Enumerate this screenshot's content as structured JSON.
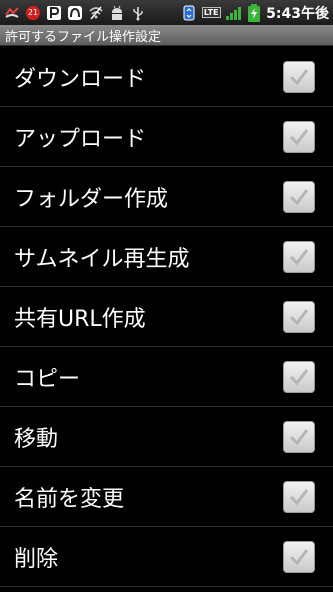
{
  "status_bar": {
    "icons_left": [
      "missed-call-icon",
      "notification-badge-icon",
      "parking-icon",
      "app-icon",
      "wifi-off-icon",
      "android-debug-icon",
      "usb-icon"
    ],
    "badge_count": "21",
    "icons_right": [
      "sync-icon",
      "lte-signal-icon",
      "signal-strength-icon",
      "battery-icon"
    ],
    "lte_label": "LTE",
    "time": "5:43午後"
  },
  "title_bar": {
    "title": "許可するファイル操作設定"
  },
  "items": [
    {
      "label": "ダウンロード",
      "checked": true
    },
    {
      "label": "アップロード",
      "checked": true
    },
    {
      "label": "フォルダー作成",
      "checked": true
    },
    {
      "label": "サムネイル再生成",
      "checked": true
    },
    {
      "label": "共有URL作成",
      "checked": true
    },
    {
      "label": "コピー",
      "checked": true
    },
    {
      "label": "移動",
      "checked": true
    },
    {
      "label": "名前を変更",
      "checked": true
    },
    {
      "label": "削除",
      "checked": true
    }
  ],
  "colors": {
    "background": "#000000",
    "checkbox_fill": "#e0e0e0",
    "check_mark": "#b5b5b5",
    "battery_green": "#3cb43c",
    "badge_red": "#d21e1e"
  }
}
